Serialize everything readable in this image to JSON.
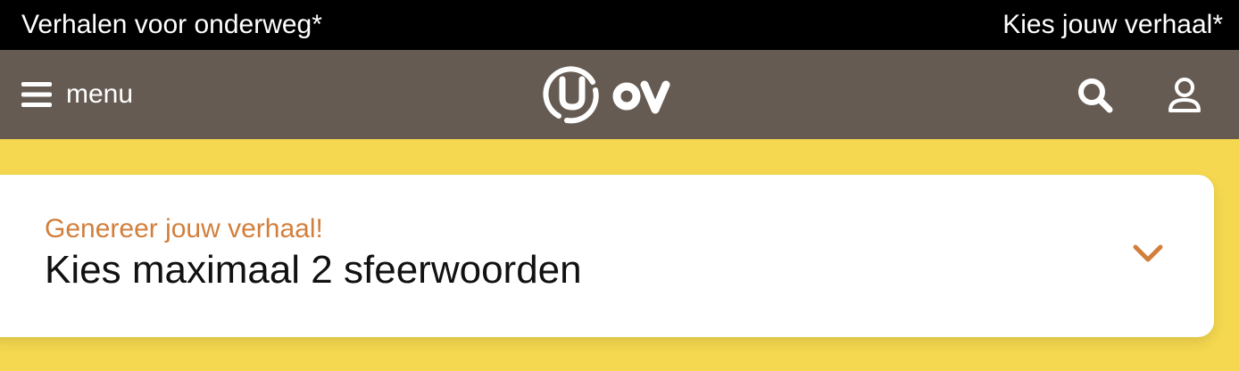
{
  "top_banner": {
    "tagline": "Verhalen voor onderweg*",
    "link_label": "Kies jouw verhaal*"
  },
  "navbar": {
    "menu_label": "menu",
    "logo_text": "U OV",
    "icons": [
      "hamburger-icon",
      "search-icon",
      "user-icon"
    ]
  },
  "card": {
    "subtitle": "Genereer jouw verhaal!",
    "title": "Kies maximaal 2 sfeerwoorden",
    "toggle_icon": "chevron-down-icon"
  },
  "colors": {
    "banner_bg": "#000000",
    "navbar_bg": "#665b52",
    "page_bg": "#f5d84f",
    "accent": "#d27f3c"
  }
}
